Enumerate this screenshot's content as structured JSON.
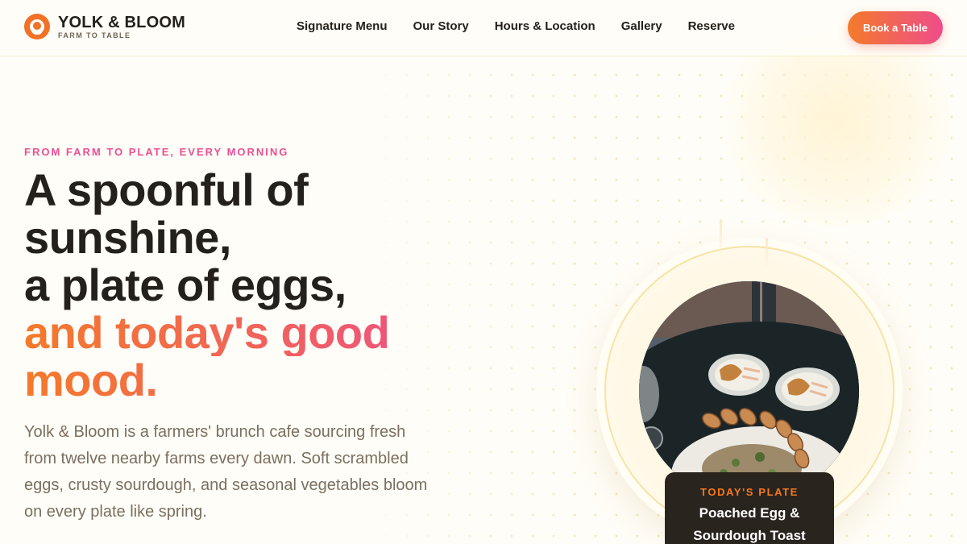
{
  "brand": {
    "name": "YOLK & BLOOM",
    "tagline": "FARM TO TABLE"
  },
  "nav": {
    "items": [
      {
        "label": "Signature Menu"
      },
      {
        "label": "Our Story"
      },
      {
        "label": "Hours & Location"
      },
      {
        "label": "Gallery"
      },
      {
        "label": "Reserve"
      }
    ],
    "cta_label": "Book a Table"
  },
  "hero": {
    "eyebrow": "FROM FARM TO PLATE, EVERY MORNING",
    "headline_line1": "A spoonful of",
    "headline_line2": "sunshine,",
    "headline_line3": "a plate of eggs,",
    "headline_highlight_line1": "and today's good",
    "headline_highlight_line2": "mood.",
    "description": "Yolk & Bloom is a farmers' brunch cafe sourcing fresh from twelve nearby farms every dawn. Soft scrambled eggs, crusty sourdough, and seasonal vegetables bloom on every plate like spring."
  },
  "feature_card": {
    "label": "TODAY'S PLATE",
    "title": "Poached Egg & Sourdough Toast"
  },
  "colors": {
    "accent_orange": "#f47a2a",
    "accent_pink": "#ee4d8a",
    "background": "#fffdf7",
    "text_dark": "#24201b",
    "text_muted": "#7a6f60"
  },
  "icons": {
    "logo": "egg-logo-icon"
  }
}
